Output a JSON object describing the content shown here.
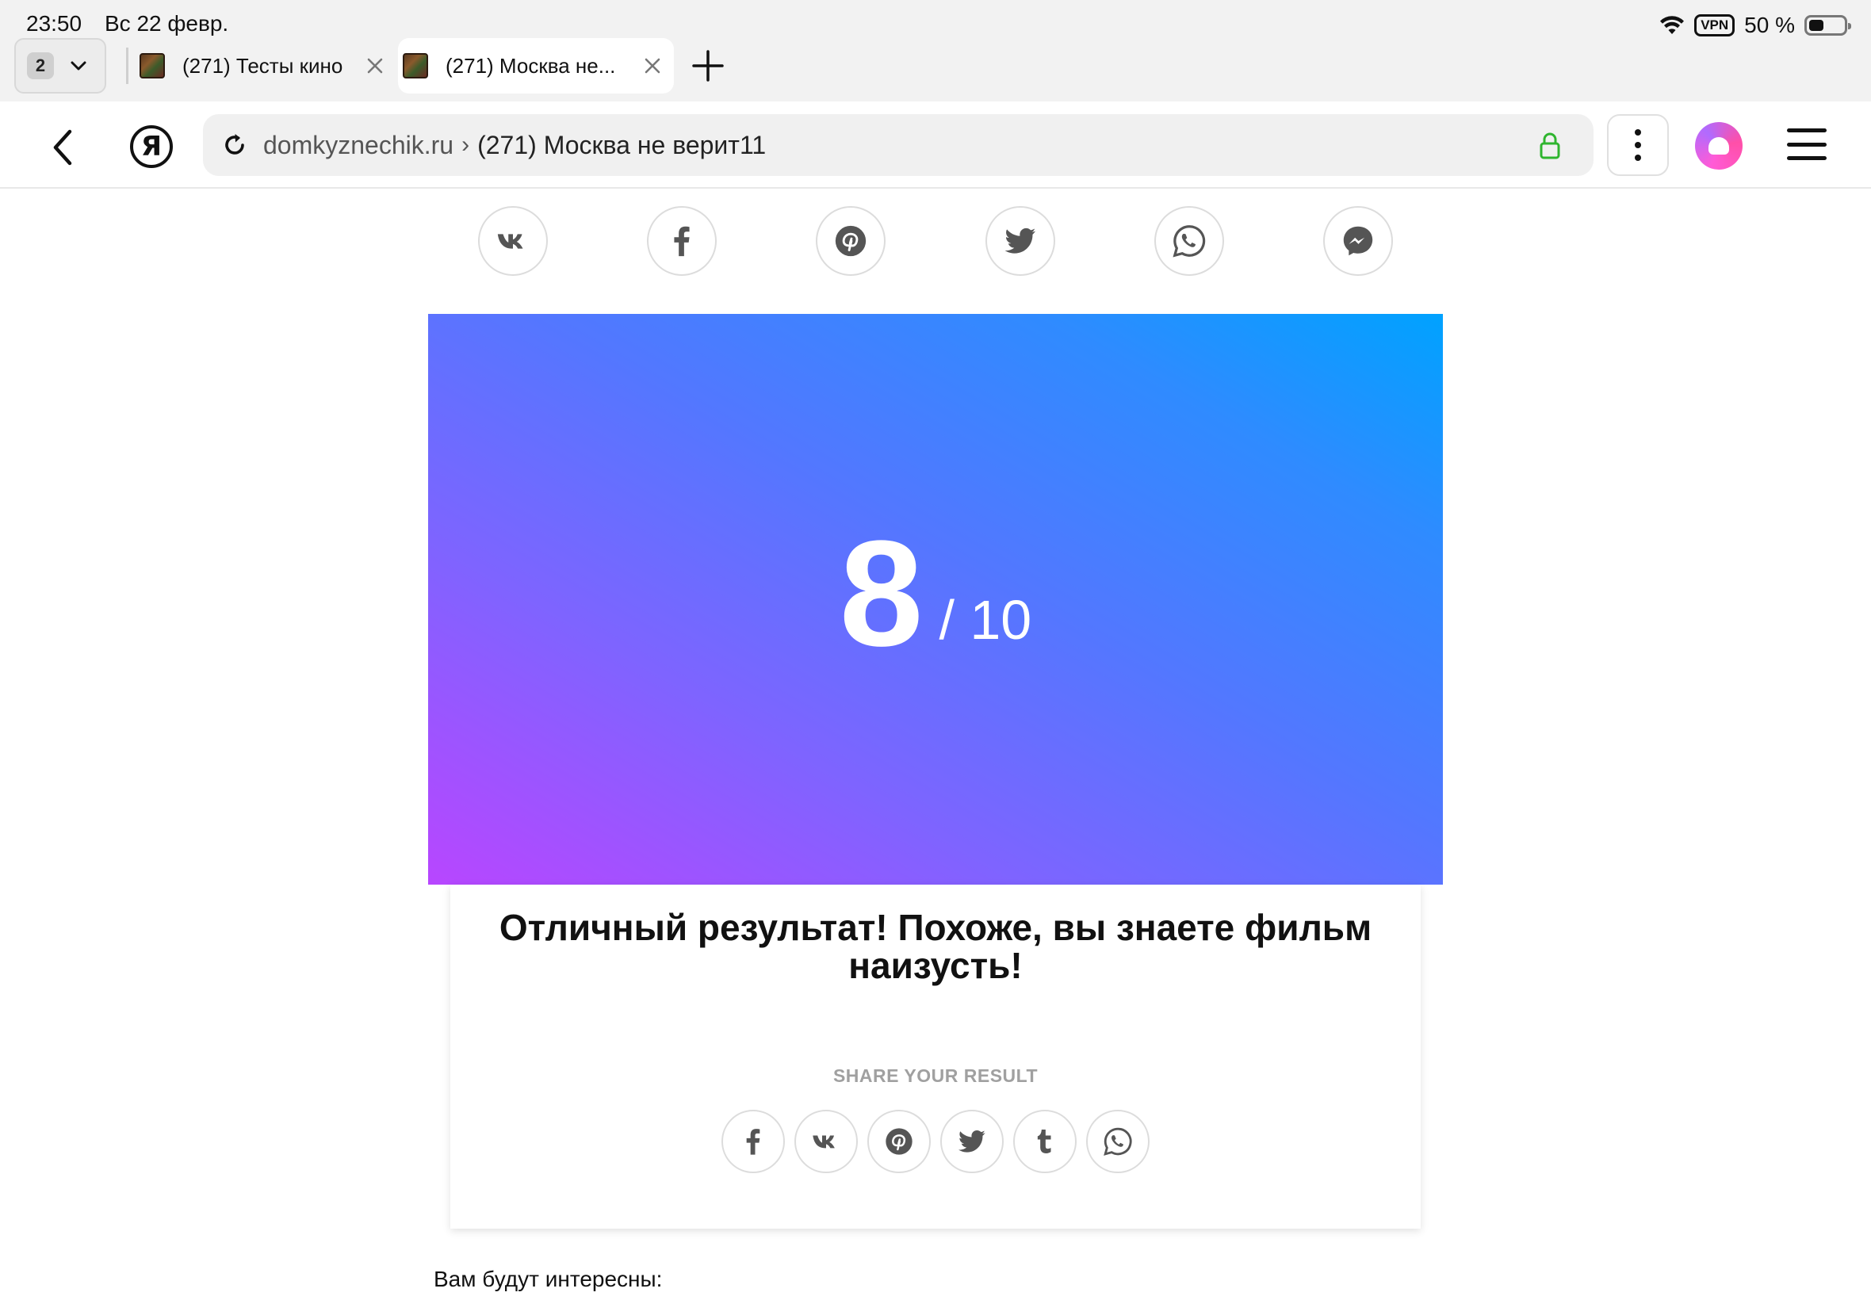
{
  "status_bar": {
    "time": "23:50",
    "date": "Вс 22 февр.",
    "vpn": "VPN",
    "battery": "50 %",
    "battery_level_percent": 50
  },
  "tabs": {
    "count": "2",
    "items": [
      {
        "title": "(271) Тесты кино",
        "active": false
      },
      {
        "title": "(271) Москва не...",
        "active": true
      }
    ]
  },
  "address_bar": {
    "host": "domkyznechik.ru",
    "separator": "›",
    "page_title": "(271) Москва не верит11",
    "yandex_logo": "Я"
  },
  "icons": {
    "back": "chevron-left-icon",
    "reload": "reload-icon",
    "lock": "lock-icon",
    "menu": "more-vertical-icon",
    "alice": "alice-icon",
    "hamburger": "hamburger-icon"
  },
  "top_share": [
    "vk-icon",
    "facebook-icon",
    "pinterest-icon",
    "twitter-icon",
    "whatsapp-icon",
    "messenger-icon"
  ],
  "result": {
    "score": "8",
    "total": "/ 10",
    "message": "Отличный результат! Похоже, вы знаете фильм наизусть!",
    "share_label": "SHARE YOUR RESULT",
    "share_icons": [
      "facebook-icon",
      "vk-icon",
      "pinterest-icon",
      "twitter-icon",
      "tumblr-icon",
      "whatsapp-icon"
    ]
  },
  "recommendations": {
    "label": "Вам будут интересны:"
  },
  "colors": {
    "icon": "#555555",
    "gradient_start": "#b846ff",
    "gradient_end": "#00a2ff",
    "lock": "#2fb52f"
  }
}
